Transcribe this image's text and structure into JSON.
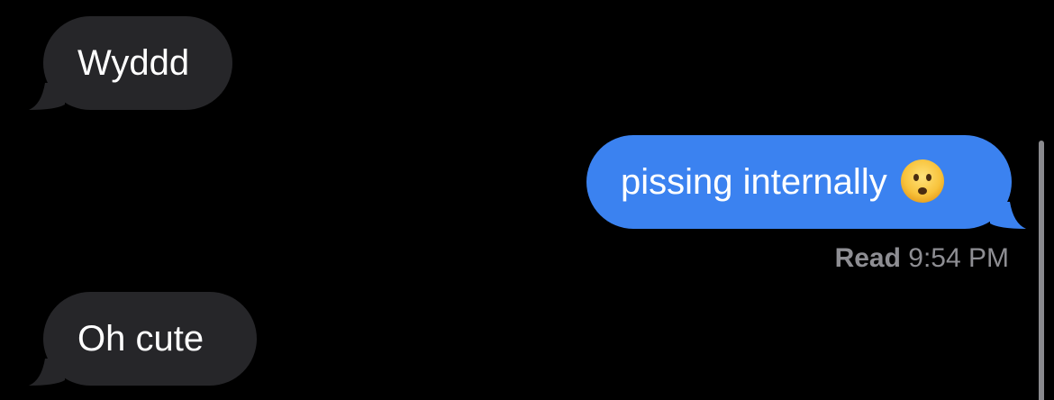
{
  "messages": [
    {
      "direction": "received",
      "text": "Wyddd"
    },
    {
      "direction": "sent",
      "text": "pissing internally",
      "emoji": "frowning-face-with-open-mouth-emoji"
    },
    {
      "direction": "received",
      "text": "Oh cute"
    }
  ],
  "receipt": {
    "label": "Read",
    "time": "9:54 PM"
  },
  "colors": {
    "background": "#000000",
    "received_bubble": "#262629",
    "sent_bubble": "#3b82f0",
    "receipt_text": "#8e8e93"
  }
}
